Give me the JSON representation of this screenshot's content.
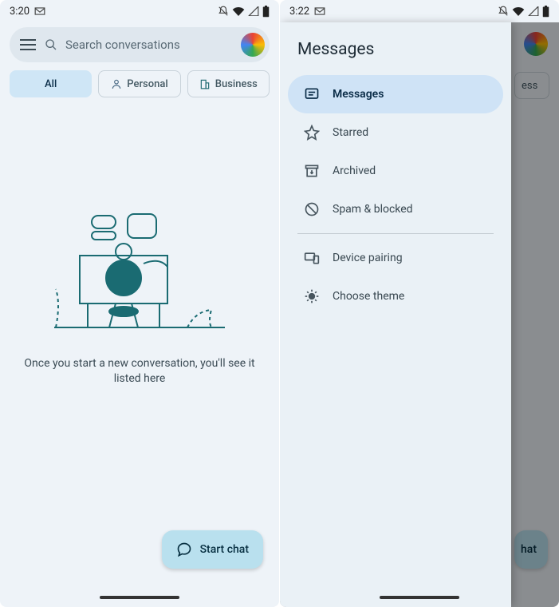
{
  "frame_left": {
    "status": {
      "time": "3:20"
    },
    "search": {
      "placeholder": "Search conversations"
    },
    "chips": {
      "all": "All",
      "personal": "Personal",
      "business": "Business"
    },
    "empty": {
      "text": "Once you start a new conversation, you'll see it listed here"
    },
    "fab": {
      "label": "Start chat"
    }
  },
  "frame_right": {
    "status": {
      "time": "3:22"
    },
    "drawer": {
      "title": "Messages",
      "items": {
        "messages": "Messages",
        "starred": "Starred",
        "archived": "Archived",
        "spam": "Spam & blocked",
        "pairing": "Device pairing",
        "theme": "Choose theme"
      }
    },
    "dim": {
      "chip_tail": "ess",
      "fab_tail": "hat"
    }
  }
}
